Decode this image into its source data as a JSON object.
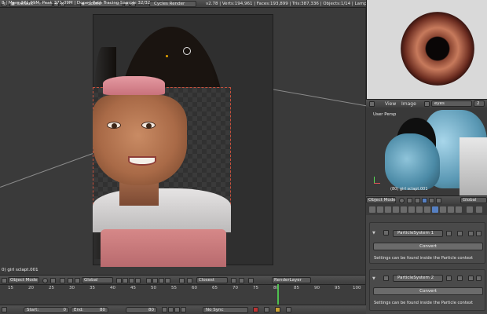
{
  "top_header": {
    "layout": "Default",
    "scene": "Scene",
    "engine": "Cycles Render",
    "stats": "v2.78 | Verts:194,961 | Faces:193,899 | Tris:387,336 | Objects:1/14 | Lamps:0/2 | Mem:421.43M | girl sclapt.001"
  },
  "viewport": {
    "render_info": "8 | Mem:371.09M, Peak:371.09M | Done | Path Tracing Sample 32/32",
    "object_label": "0) girl sclapt.001"
  },
  "viewport_header": {
    "mode": "Object Mode",
    "orientation": "Global",
    "pivot": "Closest",
    "render_layer": "RenderLayer"
  },
  "timeline": {
    "ticks": [
      "15",
      "20",
      "25",
      "30",
      "35",
      "40",
      "45",
      "50",
      "55",
      "60",
      "65",
      "70",
      "75",
      "80",
      "85",
      "90",
      "95",
      "100"
    ],
    "start_label": "Start:",
    "start_value": "0",
    "end_label": "End:",
    "end_value": "80",
    "current_frame": "80",
    "sync": "No Sync"
  },
  "image_editor": {
    "menu_view": "View",
    "menu_image": "Image",
    "image_name": "eyes",
    "users": "2"
  },
  "mini_viewport": {
    "label": "User Persp",
    "object_label": "(80) girl sclapt.001",
    "mode": "Object Mode",
    "orientation": "Global"
  },
  "properties": {
    "particle_systems": [
      {
        "name": "ParticleSystem 1",
        "button": "Convert",
        "note": "Settings can be found inside the Particle context"
      },
      {
        "name": "ParticleSystem 2",
        "button": "Convert",
        "note": "Settings can be found inside the Particle context"
      }
    ]
  },
  "colors": {
    "selection_outline": "#c8503c",
    "playhead": "#4fc04f",
    "active_tab": "#5680c2"
  }
}
